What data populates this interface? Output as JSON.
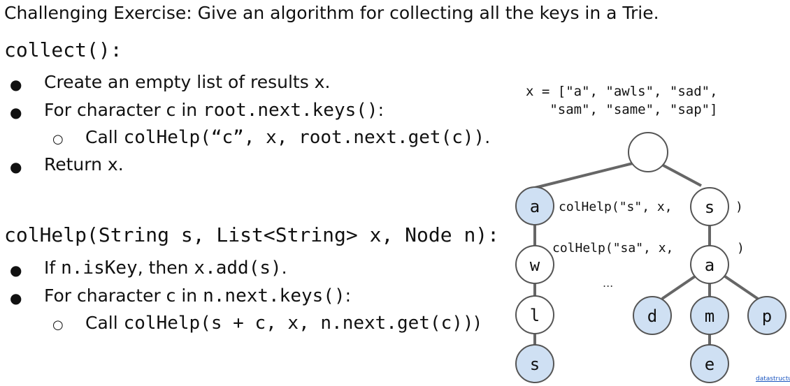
{
  "title": "Challenging Exercise: Give an algorithm for collecting all the keys in a Trie.",
  "collect": {
    "heading": "collect():",
    "steps": [
      {
        "text": "Create an empty list of results x."
      },
      {
        "pre": "For character c in ",
        "code": "root.next.keys()",
        "post": ":"
      },
      {
        "pre": "Call ",
        "code": "colHelp(“c”, x, root.next.get(c))",
        "post": "."
      },
      {
        "text": "Return x."
      }
    ]
  },
  "colhelp": {
    "heading": "colHelp(String s, List<String> x, Node n):",
    "steps": [
      {
        "pre": "If ",
        "code1": "n.isKey",
        "mid": ", then ",
        "code2": "x.add(s)",
        "post": "."
      },
      {
        "pre": "For character c in ",
        "code": "n.next.keys()",
        "post": ":"
      },
      {
        "pre": "Call ",
        "code": "colHelp(s + c, x, n.next.get(c))",
        "post": ")"
      }
    ]
  },
  "bullets": {
    "main": "●",
    "sub": "○"
  },
  "xlist": {
    "line1": "x = [\"a\", \"awls\", \"sad\",",
    "line2": "\"sam\", \"same\", \"sap\"]"
  },
  "trie": {
    "root_label": "",
    "nodes": {
      "a": "a",
      "w": "w",
      "l": "l",
      "s_end": "s",
      "s": "s",
      "a2": "a",
      "d": "d",
      "m": "m",
      "p": "p",
      "e": "e"
    },
    "key_color": "#cfe0f3",
    "call1": {
      "pre": "colHelp(\"s\", x,",
      "post": ")"
    },
    "call2": {
      "pre": "colHelp(\"sa\", x,",
      "post": ")"
    },
    "ellipsis": "..."
  },
  "source": "datastructur"
}
